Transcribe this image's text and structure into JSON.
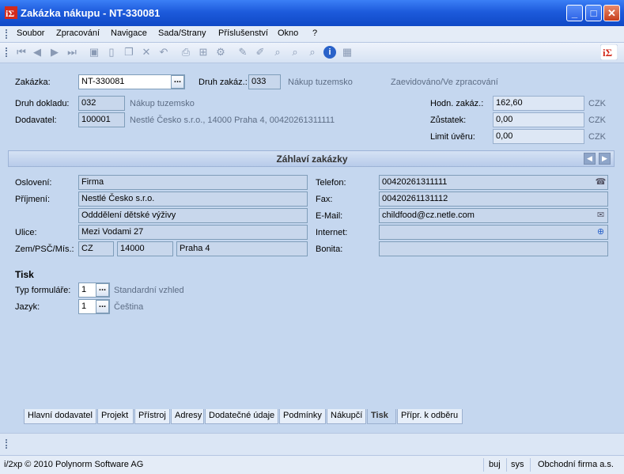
{
  "window": {
    "title": "Zakázka nákupu - NT-330081",
    "minimize_glyph": "_",
    "maximize_glyph": "□",
    "close_glyph": "✕"
  },
  "menu": [
    "Soubor",
    "Zpracování",
    "Navigace",
    "Sada/Strany",
    "Příslušenství",
    "Okno",
    "?"
  ],
  "toolbar_icons": [
    "first-record-icon",
    "previous-record-icon",
    "next-record-icon",
    "last-record-icon",
    "save-icon",
    "new-icon",
    "copy-icon",
    "delete-icon",
    "undo-icon",
    "print-icon",
    "print-setup-icon",
    "settings-icon",
    "edit-icon",
    "edit-alt-icon",
    "search-icon",
    "find-icon",
    "filter-icon",
    "info-icon",
    "calculator-icon"
  ],
  "header": {
    "order_label": "Zakázka:",
    "order_value": "NT-330081",
    "order_type_label": "Druh zakáz.:",
    "order_type_value": "033",
    "order_type_desc": "Nákup tuzemsko",
    "status_text": "Zaevidováno/Ve zpracování",
    "doc_type_label": "Druh dokladu:",
    "doc_type_value": "032",
    "doc_type_desc": "Nákup tuzemsko",
    "supplier_label": "Dodavatel:",
    "supplier_value": "100001",
    "supplier_desc": "Nestlé Česko s.r.o., 14000 Praha 4, 00420261311111",
    "order_value_label": "Hodn. zakáz.:",
    "order_value_amount": "162,60",
    "balance_label": "Zůstatek:",
    "balance_amount": "0,00",
    "credit_limit_label": "Limit úvěru:",
    "credit_limit_amount": "0,00",
    "currency": "CZK"
  },
  "section": {
    "title": "Záhlaví zakázky",
    "prev_glyph": "◀",
    "next_glyph": "▶"
  },
  "address": {
    "salutation_label": "Oslovení:",
    "salutation": "Firma",
    "surname_label": "Příjmení:",
    "surname": "Nestlé Česko s.r.o.",
    "department": "Odddělení dětské výživy",
    "street_label": "Ulice:",
    "street": "Mezi Vodami 27",
    "country_zip_city_label": "Zem/PSČ/Mís.:",
    "country": "CZ",
    "zip": "14000",
    "city": "Praha 4",
    "phone_label": "Telefon:",
    "phone": "00420261311111",
    "fax_label": "Fax:",
    "fax": "00420261131112",
    "email_label": "E-Mail:",
    "email": "childfood@cz.netle.com",
    "internet_label": "Internet:",
    "internet": "",
    "rating_label": "Bonita:",
    "rating": ""
  },
  "print": {
    "heading": "Tisk",
    "form_type_label": "Typ formuláře:",
    "form_type_value": "1",
    "form_type_desc": "Standardní vzhled",
    "language_label": "Jazyk:",
    "language_value": "1",
    "language_desc": "Čeština",
    "ellipsis": "..."
  },
  "tabs": [
    {
      "label": "Hlavní dodavatel",
      "active": false
    },
    {
      "label": "Projekt",
      "active": false
    },
    {
      "label": "Přístroj",
      "active": false
    },
    {
      "label": "Adresy",
      "active": false
    },
    {
      "label": "Dodatečné údaje",
      "active": false
    },
    {
      "label": "Podmínky",
      "active": false
    },
    {
      "label": "Nákupčí",
      "active": false
    },
    {
      "label": "Tisk",
      "active": true
    },
    {
      "label": "Přípr. k odběru",
      "active": false
    }
  ],
  "status_bar": {
    "copyright": "i/2xp © 2010 Polynorm Software AG",
    "user": "buj",
    "system": "sys",
    "company": "Obchodní firma a.s."
  },
  "colors": {
    "titlebar": "#1d5bdc",
    "background": "#c5d7ef",
    "logo_red": "#d42a1b"
  }
}
